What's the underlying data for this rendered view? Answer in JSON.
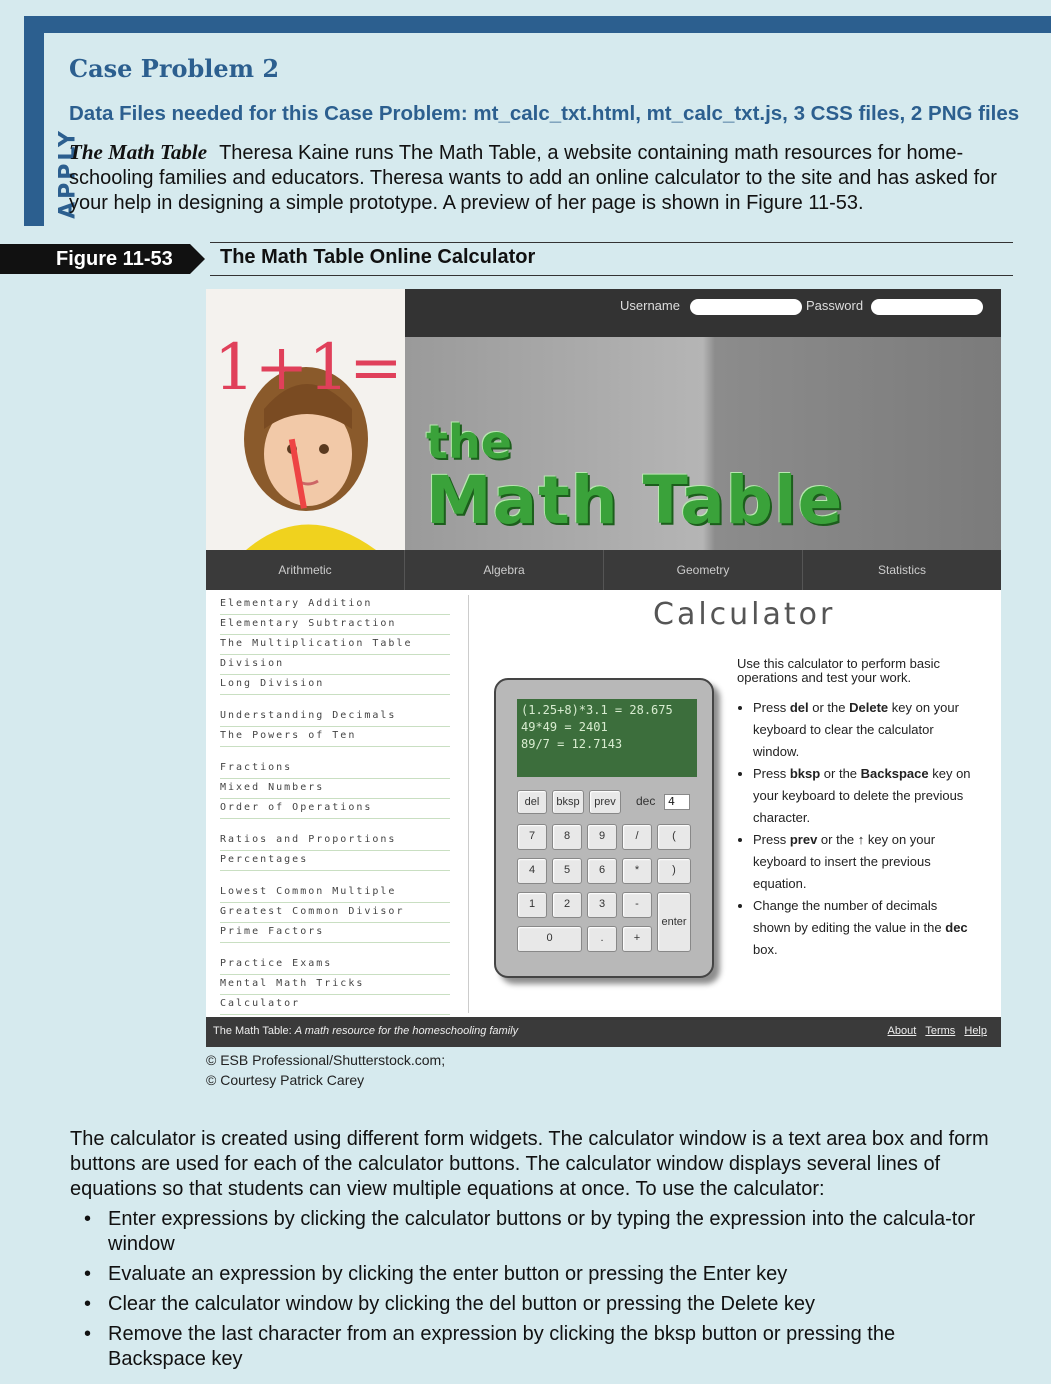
{
  "sidebar_label": "APPLY",
  "case_title": "Case Problem 2",
  "data_files": "Data Files needed for this Case Problem: mt_calc_txt.html, mt_calc_txt.js, 3 CSS files, 2 PNG files",
  "intro_lead": "The Math Table",
  "intro_text": "Theresa Kaine runs The Math Table, a website containing math resources for home-schooling families and educators. Theresa wants to add an online calculator to the site and has asked for your help in designing a simple prototype. A preview of her page is shown in Figure 11-53.",
  "figure": {
    "label": "Figure 11-53",
    "title": "The Math Table Online Calculator"
  },
  "site": {
    "username_label": "Username",
    "password_label": "Password",
    "logo_the": "the",
    "logo_main": "Math Table",
    "photo_text": "1+1=2",
    "nav": [
      "Arithmetic",
      "Algebra",
      "Geometry",
      "Statistics"
    ],
    "sidenav": [
      [
        "Elementary Addition",
        "Elementary Subtraction",
        "The Multiplication Table",
        "Division",
        "Long Division"
      ],
      [
        "Understanding Decimals",
        "The Powers of Ten"
      ],
      [
        "Fractions",
        "Mixed Numbers",
        "Order of Operations"
      ],
      [
        "Ratios and Proportions",
        "Percentages"
      ],
      [
        "Lowest Common Multiple",
        "Greatest Common Divisor",
        "Prime Factors"
      ],
      [
        "Practice Exams",
        "Mental Math Tricks",
        "Calculator"
      ]
    ],
    "calc_heading": "Calculator",
    "calc_screen": [
      "(1.25+8)*3.1 = 28.675",
      "49*49 = 2401",
      "89/7 = 12.7143"
    ],
    "calc_buttons": {
      "del": "del",
      "bksp": "bksp",
      "prev": "prev",
      "dec": "dec",
      "dec_value": "4",
      "r1": [
        "7",
        "8",
        "9",
        "/",
        "("
      ],
      "r2": [
        "4",
        "5",
        "6",
        "*",
        ")"
      ],
      "r3": [
        "1",
        "2",
        "3",
        "-"
      ],
      "zero": "0",
      "point": ".",
      "plus": "+",
      "enter": "enter"
    },
    "instr_intro": "Use this calculator to perform basic operations and test your work.",
    "instr_items": [
      [
        "Press ",
        "del",
        " or the ",
        "Delete",
        " key on your keyboard to clear the calculator window."
      ],
      [
        "Press ",
        "bksp",
        " or the ",
        "Backspace",
        " key on your keyboard to delete the previous character."
      ],
      [
        "Press ",
        "prev",
        " or the ↑ key on your keyboard to insert the previous equation.",
        "",
        ""
      ],
      [
        "Change the number of decimals shown by editing the value in the ",
        "dec",
        " box.",
        "",
        ""
      ]
    ],
    "footer_text_a": "The Math Table: ",
    "footer_text_b": "A math resource for the homeschooling family",
    "footer_links": [
      "About",
      "Terms",
      "Help"
    ]
  },
  "credits": [
    "© ESB Professional/Shutterstock.com;",
    "© Courtesy Patrick Carey"
  ],
  "body_text": "The calculator is created using different form widgets. The calculator window is a text area box and form buttons are used for each of the calculator buttons. The calculator window displays several lines of equations so that students can view multiple equations at once. To use the calculator:",
  "bullets": [
    "Enter expressions by clicking the calculator buttons or by typing the expression into the calcula-tor window",
    "Evaluate an expression by clicking the enter button or pressing the Enter key",
    "Clear the calculator window by clicking the del button or pressing the Delete key",
    "Remove the last character from an expression by clicking the bksp button or pressing the Backspace key"
  ],
  "colors": {
    "accent": "#2c5f8f",
    "background": "#d6eaee",
    "calc_screen": "#3c6e3c",
    "logo_green": "#3aa23a"
  }
}
